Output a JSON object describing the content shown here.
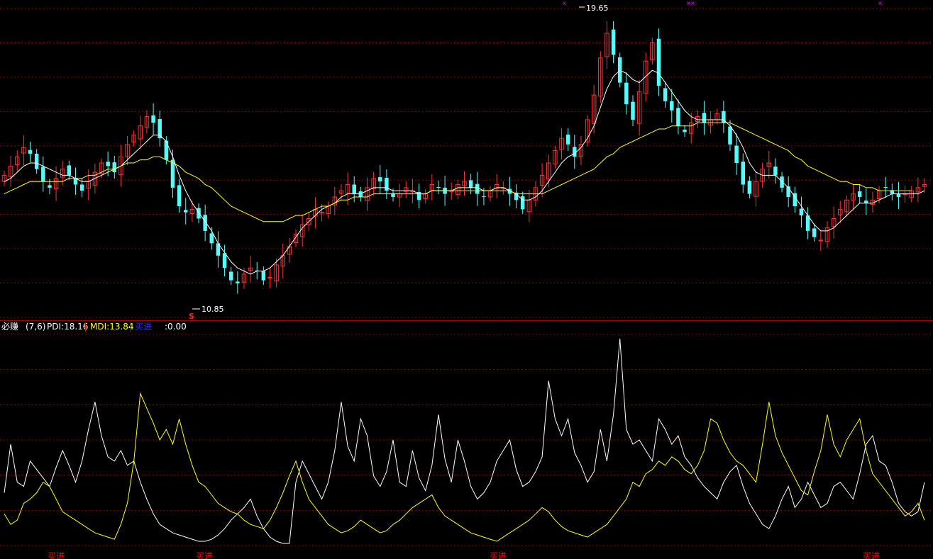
{
  "indicator": {
    "name": "必赚",
    "params": "(7,6)",
    "pdi_label": "PDI:",
    "pdi_value": "18.16",
    "mdi_label": "MDI:",
    "mdi_value": "13.84",
    "buy_label": "买进",
    "buy_value": ":0.00"
  },
  "annotations": {
    "high_label": "19.65",
    "low_label": "10.85",
    "low_marker": "S",
    "buy_signal_text": "买进"
  },
  "colors": {
    "background": "#000000",
    "grid": "#8b0000",
    "up_candle": "#ff3232",
    "down_candle": "#54fcfc",
    "ma_short": "#ffffff",
    "ma_long": "#ffff00",
    "pdi_line": "#ffffff",
    "mdi_line": "#ffff00",
    "buy_text": "#ff0000",
    "buy_label_color": "#0000ff",
    "marker": "#ff00ff"
  },
  "chart_data": [
    {
      "type": "candlestick",
      "price_range": [
        10.0,
        20.0
      ],
      "high": 19.65,
      "low": 10.85,
      "grid": true,
      "series": [
        {
          "name": "close",
          "values": [
            14.6,
            14.9,
            15.2,
            15.5,
            15.3,
            14.8,
            14.4,
            14.2,
            14.5,
            14.8,
            14.6,
            14.3,
            14.1,
            14.4,
            14.7,
            15.0,
            14.9,
            14.7,
            15.2,
            15.6,
            15.9,
            16.2,
            16.5,
            16.3,
            15.8,
            15.1,
            14.2,
            13.6,
            13.4,
            13.5,
            13.2,
            12.8,
            12.4,
            12.0,
            11.6,
            11.2,
            11.1,
            11.4,
            11.6,
            11.5,
            11.2,
            11.3,
            11.7,
            12.0,
            12.3,
            12.7,
            13.0,
            13.2,
            13.5,
            13.4,
            13.6,
            13.9,
            14.1,
            14.3,
            14.0,
            13.9,
            14.2,
            14.5,
            14.4,
            14.1,
            13.9,
            14.0,
            14.2,
            14.1,
            13.8,
            14.0,
            14.3,
            14.2,
            14.0,
            14.1,
            14.3,
            14.4,
            14.2,
            14.0,
            13.9,
            14.1,
            14.3,
            14.2,
            14.0,
            13.8,
            13.5,
            13.8,
            14.2,
            14.6,
            15.0,
            15.4,
            15.8,
            15.6,
            15.2,
            15.6,
            16.4,
            17.2,
            18.4,
            19.2,
            18.5,
            17.6,
            16.9,
            16.4,
            17.3,
            18.3,
            18.9,
            17.5,
            17.0,
            16.7,
            16.2,
            16.0,
            16.3,
            16.5,
            16.3,
            16.4,
            16.6,
            16.3,
            15.6,
            15.0,
            14.3,
            14.0,
            14.4,
            14.8,
            15.0,
            14.6,
            14.2,
            13.9,
            13.6,
            13.3,
            12.8,
            12.6,
            12.5,
            12.9,
            13.2,
            13.5,
            13.8,
            14.0,
            13.9,
            13.7,
            13.8,
            14.1,
            14.2,
            14.0,
            13.9,
            14.0,
            14.1,
            14.2,
            14.3
          ]
        },
        {
          "name": "MA short",
          "values": [
            14.4,
            14.5,
            14.7,
            14.9,
            15.0,
            15.0,
            14.9,
            14.8,
            14.7,
            14.6,
            14.6,
            14.5,
            14.4,
            14.4,
            14.5,
            14.6,
            14.7,
            14.8,
            14.9,
            15.1,
            15.3,
            15.5,
            15.7,
            15.9,
            15.9,
            15.7,
            15.2,
            14.6,
            14.1,
            13.7,
            13.4,
            13.1,
            12.8,
            12.4,
            12.1,
            11.8,
            11.6,
            11.5,
            11.4,
            11.5,
            11.5,
            11.6,
            11.8,
            12.0,
            12.3,
            12.6,
            12.9,
            13.1,
            13.3,
            13.5,
            13.6,
            13.7,
            13.9,
            14.0,
            14.0,
            14.0,
            14.1,
            14.2,
            14.2,
            14.2,
            14.1,
            14.1,
            14.1,
            14.1,
            14.0,
            14.0,
            14.1,
            14.1,
            14.1,
            14.1,
            14.2,
            14.2,
            14.2,
            14.2,
            14.1,
            14.1,
            14.2,
            14.2,
            14.1,
            14.0,
            13.8,
            13.8,
            13.9,
            14.1,
            14.4,
            14.7,
            15.0,
            15.2,
            15.3,
            15.5,
            15.8,
            16.2,
            16.8,
            17.4,
            17.8,
            18.0,
            17.9,
            17.7,
            17.6,
            17.8,
            18.0,
            17.9,
            17.6,
            17.3,
            17.0,
            16.7,
            16.5,
            16.4,
            16.4,
            16.4,
            16.4,
            16.4,
            16.2,
            15.9,
            15.5,
            15.0,
            14.7,
            14.6,
            14.6,
            14.6,
            14.4,
            14.2,
            13.9,
            13.6,
            13.3,
            13.0,
            12.8,
            12.8,
            12.9,
            13.1,
            13.3,
            13.5,
            13.7,
            13.7,
            13.7,
            13.8,
            13.9,
            14.0,
            14.0,
            14.0,
            14.0,
            14.0,
            14.1
          ]
        },
        {
          "name": "MA long",
          "values": [
            14.0,
            14.1,
            14.2,
            14.3,
            14.4,
            14.4,
            14.4,
            14.4,
            14.4,
            14.4,
            14.5,
            14.5,
            14.5,
            14.6,
            14.6,
            14.7,
            14.8,
            14.8,
            14.9,
            15.0,
            15.0,
            15.1,
            15.1,
            15.2,
            15.2,
            15.1,
            15.0,
            14.9,
            14.7,
            14.6,
            14.5,
            14.3,
            14.2,
            14.0,
            13.8,
            13.6,
            13.5,
            13.4,
            13.3,
            13.2,
            13.1,
            13.1,
            13.1,
            13.1,
            13.2,
            13.3,
            13.3,
            13.4,
            13.5,
            13.6,
            13.6,
            13.7,
            13.8,
            13.8,
            13.9,
            13.9,
            13.9,
            14.0,
            14.0,
            14.0,
            14.0,
            14.0,
            14.0,
            14.0,
            14.0,
            14.0,
            14.1,
            14.1,
            14.1,
            14.1,
            14.1,
            14.1,
            14.1,
            14.1,
            14.1,
            14.1,
            14.1,
            14.1,
            14.1,
            14.0,
            14.0,
            14.0,
            14.0,
            14.0,
            14.1,
            14.2,
            14.3,
            14.4,
            14.5,
            14.6,
            14.7,
            14.8,
            15.0,
            15.2,
            15.3,
            15.5,
            15.6,
            15.7,
            15.8,
            15.9,
            16.0,
            16.1,
            16.1,
            16.2,
            16.2,
            16.2,
            16.2,
            16.3,
            16.3,
            16.3,
            16.3,
            16.3,
            16.3,
            16.2,
            16.1,
            16.0,
            15.9,
            15.8,
            15.7,
            15.6,
            15.5,
            15.4,
            15.2,
            15.1,
            14.9,
            14.8,
            14.7,
            14.6,
            14.5,
            14.4,
            14.4,
            14.3,
            14.3,
            14.2,
            14.2,
            14.1,
            14.1,
            14.1,
            14.1,
            14.1,
            14.1
          ]
        }
      ]
    },
    {
      "type": "line",
      "title": "必赚",
      "ylim": [
        0,
        100
      ],
      "grid": true,
      "series": [
        {
          "name": "PDI",
          "values": [
            25,
            48,
            30,
            28,
            40,
            36,
            32,
            28,
            37,
            45,
            38,
            30,
            40,
            55,
            68,
            52,
            42,
            40,
            45,
            38,
            40,
            30,
            22,
            15,
            10,
            8,
            6,
            5,
            4,
            3,
            2,
            2,
            3,
            5,
            8,
            12,
            15,
            18,
            22,
            14,
            8,
            4,
            2,
            1,
            1,
            30,
            40,
            34,
            28,
            22,
            30,
            45,
            68,
            47,
            40,
            60,
            52,
            33,
            28,
            35,
            50,
            30,
            28,
            45,
            32,
            26,
            38,
            62,
            41,
            30,
            50,
            40,
            28,
            22,
            25,
            30,
            40,
            45,
            50,
            36,
            28,
            30,
            35,
            42,
            78,
            60,
            52,
            60,
            44,
            38,
            30,
            35,
            55,
            40,
            62,
            98,
            55,
            48,
            50,
            45,
            40,
            60,
            55,
            48,
            52,
            42,
            38,
            32,
            28,
            25,
            22,
            30,
            35,
            38,
            28,
            20,
            15,
            10,
            8,
            14,
            22,
            28,
            18,
            22,
            30,
            24,
            18,
            20,
            28,
            30,
            26,
            22,
            34,
            48,
            52,
            40,
            38,
            30,
            20,
            16,
            14,
            16,
            30
          ]
        },
        {
          "name": "MDI",
          "values": [
            15,
            10,
            12,
            20,
            22,
            25,
            30,
            28,
            22,
            16,
            14,
            12,
            10,
            8,
            6,
            5,
            4,
            3,
            10,
            20,
            40,
            72,
            65,
            58,
            50,
            55,
            48,
            60,
            48,
            38,
            30,
            28,
            24,
            20,
            18,
            16,
            15,
            12,
            10,
            9,
            8,
            12,
            18,
            25,
            33,
            40,
            30,
            22,
            18,
            14,
            10,
            8,
            6,
            7,
            9,
            12,
            10,
            8,
            6,
            7,
            10,
            12,
            15,
            18,
            20,
            22,
            24,
            18,
            14,
            12,
            10,
            8,
            6,
            5,
            4,
            3,
            2,
            4,
            6,
            8,
            10,
            12,
            15,
            18,
            16,
            12,
            9,
            7,
            6,
            5,
            4,
            6,
            8,
            10,
            14,
            18,
            22,
            30,
            28,
            34,
            36,
            40,
            38,
            42,
            40,
            36,
            34,
            38,
            45,
            60,
            58,
            50,
            44,
            40,
            38,
            34,
            30,
            48,
            68,
            52,
            44,
            38,
            32,
            26,
            24,
            35,
            45,
            62,
            48,
            42,
            50,
            55,
            60,
            45,
            34,
            30,
            26,
            22,
            18,
            14,
            16,
            20,
            12
          ]
        }
      ]
    }
  ]
}
